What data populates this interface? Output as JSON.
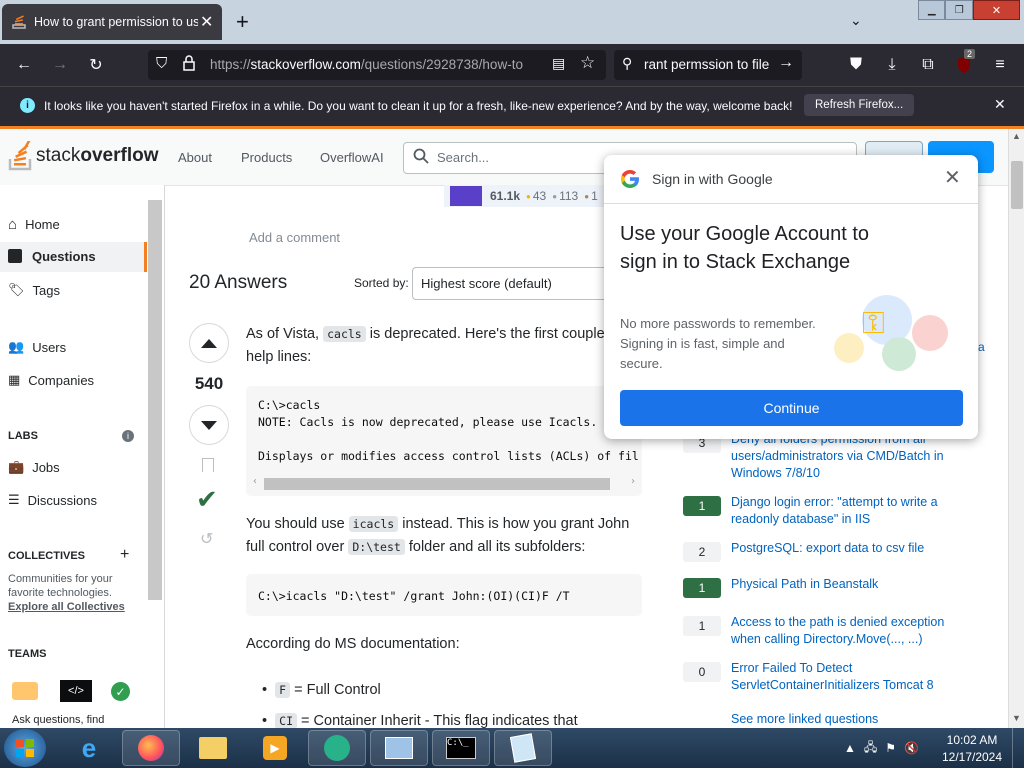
{
  "browser": {
    "tab_title": "How to grant permission to use",
    "url_prefix": "https://",
    "url_host": "stackoverflow.com",
    "url_path": "/questions/2928738/how-to",
    "search_text": "rant permssion to file",
    "ext_badge": "2",
    "notification_text": "It looks like you haven't started Firefox in a while. Do you want to clean it up for a fresh, like-new experience? And by the way, welcome back!",
    "refresh_label": "Refresh Firefox..."
  },
  "so_header": {
    "logo_stack": "stack",
    "logo_overflow": "overflow",
    "nav": [
      "About",
      "Products",
      "OverflowAI"
    ],
    "search_placeholder": "Search..."
  },
  "sidebar": {
    "home": "Home",
    "questions": "Questions",
    "tags": "Tags",
    "users": "Users",
    "companies": "Companies",
    "labs_heading": "LABS",
    "jobs": "Jobs",
    "discussions": "Discussions",
    "collectives_heading": "COLLECTIVES",
    "collectives_text": "Communities for your favorite technologies.",
    "explore_link": "Explore all Collectives",
    "teams_heading": "TEAMS",
    "teams_text": "Ask questions, find"
  },
  "user_card": {
    "reputation": "61.1k",
    "gold": "43",
    "silver": "113",
    "bronze": "1"
  },
  "main": {
    "add_comment": "Add a comment",
    "answers_count": "20 Answers",
    "sorted_by_label": "Sorted by:",
    "sort_value": "Highest score (default)",
    "vote_count": "540",
    "p1_a": "As of Vista,",
    "p1_code": "cacls",
    "p1_b": "is deprecated. Here's the first couple",
    "p1_c": "help lines:",
    "code1_line1": "C:\\>cacls",
    "code1_line2": "NOTE: Cacls is now deprecated, please use Icacls.",
    "code1_line3": "Displays or modifies access control lists (ACLs) of fil",
    "p2_a": "You should use",
    "p2_code": "icacls",
    "p2_b": "instead. This is how you grant John",
    "p2_c": "full control over",
    "p2_code2": "D:\\test",
    "p2_d": "folder and all its subfolders:",
    "code2": "C:\\>icacls \"D:\\test\" /grant John:(OI)(CI)F /T",
    "p3": "According do MS documentation:",
    "bullet1_code": "F",
    "bullet1_text": "= Full Control",
    "bullet2_code": "CI",
    "bullet2_text": "= Container Inherit - This flag indicates that"
  },
  "linked": {
    "items": [
      {
        "count": "3",
        "title": "Deny all folders permission from all users/administrators via CMD/Batch in Windows 7/8/10",
        "accepted": false
      },
      {
        "count": "1",
        "title": "Django login error: \"attempt to write a readonly database\" in IIS",
        "accepted": true
      },
      {
        "count": "2",
        "title": "PostgreSQL: export data to csv file",
        "accepted": false
      },
      {
        "count": "1",
        "title": "Physical Path in Beanstalk",
        "accepted": true
      },
      {
        "count": "1",
        "title": "Access to the path is denied exception when calling Directory.Move(..., ...)",
        "accepted": false
      },
      {
        "count": "0",
        "title": "Error Failed To Detect ServletContainerInitializers Tomcat 8",
        "accepted": false
      }
    ],
    "see_more": "See more linked questions"
  },
  "google_popup": {
    "header": "Sign in with Google",
    "title": "Use your Google Account to sign in to Stack Exchange",
    "body": "No more passwords to remember. Signing in is fast, simple and secure.",
    "continue_label": "Continue"
  },
  "taskbar": {
    "time": "10:02 AM",
    "date": "12/17/2024"
  },
  "colors": {
    "accent_orange": "#f48024",
    "link_blue": "#0063bf",
    "accepted_green": "#2f6f44",
    "google_blue": "#1a73e8"
  }
}
